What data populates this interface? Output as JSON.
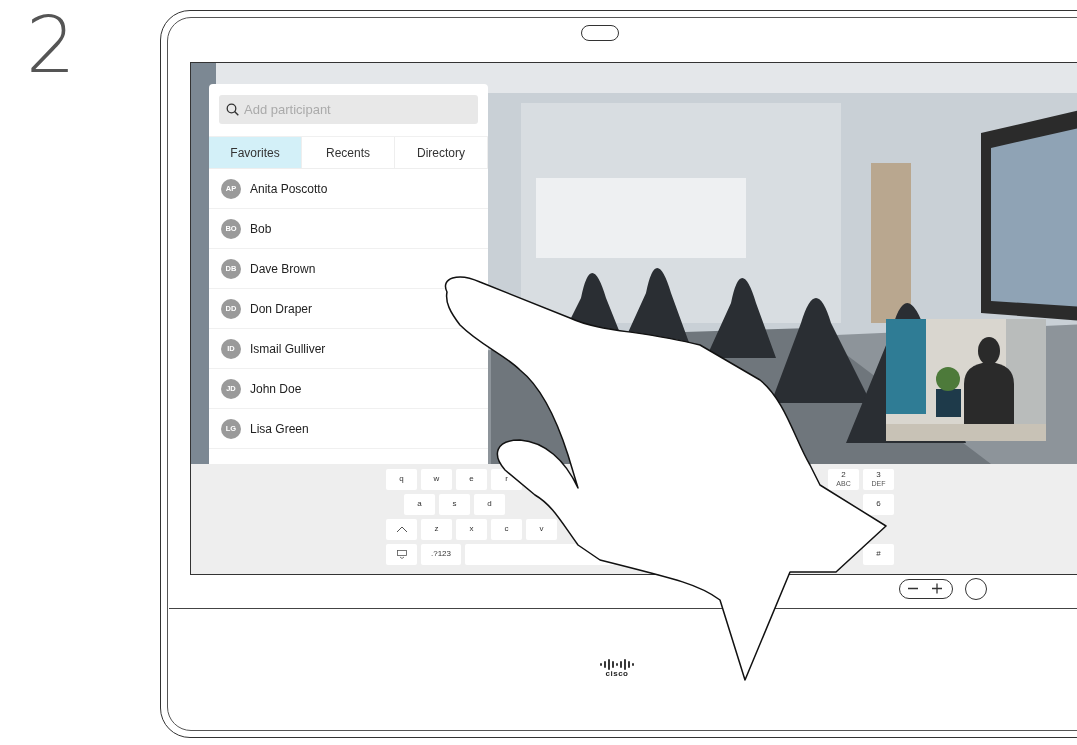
{
  "step": "2",
  "search": {
    "placeholder": "Add participant"
  },
  "tabs": [
    {
      "label": "Favorites",
      "selected": true
    },
    {
      "label": "Recents",
      "selected": false
    },
    {
      "label": "Directory",
      "selected": false
    }
  ],
  "contacts": [
    {
      "initials": "AP",
      "name": "Anita Poscotto"
    },
    {
      "initials": "BO",
      "name": "Bob"
    },
    {
      "initials": "DB",
      "name": "Dave Brown"
    },
    {
      "initials": "DD",
      "name": "Don Draper"
    },
    {
      "initials": "ID",
      "name": "Ismail Gulliver"
    },
    {
      "initials": "JD",
      "name": "John Doe"
    },
    {
      "initials": "LG",
      "name": "Lisa Green"
    }
  ],
  "keyboard": {
    "left_rows": [
      [
        {
          "kind": "char",
          "label": "q"
        },
        {
          "kind": "char",
          "label": "w"
        },
        {
          "kind": "char",
          "label": "e"
        },
        {
          "kind": "char",
          "label": "r"
        }
      ],
      [
        {
          "kind": "char",
          "label": "a"
        },
        {
          "kind": "char",
          "label": "s"
        },
        {
          "kind": "char",
          "label": "d"
        }
      ],
      [
        {
          "kind": "shift"
        },
        {
          "kind": "char",
          "label": "z"
        },
        {
          "kind": "char",
          "label": "x"
        },
        {
          "kind": "char",
          "label": "c"
        },
        {
          "kind": "char",
          "label": "v"
        }
      ],
      [
        {
          "kind": "hide"
        },
        {
          "kind": "char",
          "label": ".?123"
        },
        {
          "kind": "space"
        }
      ]
    ],
    "right_rows": [
      [
        {
          "kind": "char",
          "label": "2",
          "sub": "ABC"
        },
        {
          "kind": "char",
          "label": "3",
          "sub": "DEF"
        }
      ],
      [
        {
          "kind": "blank"
        },
        {
          "kind": "char",
          "label": "6"
        }
      ],
      [
        {
          "kind": "blank"
        },
        {
          "kind": "blank"
        }
      ],
      [
        {
          "kind": "blank"
        },
        {
          "kind": "char",
          "label": "#"
        }
      ]
    ]
  },
  "brand": "cisco"
}
